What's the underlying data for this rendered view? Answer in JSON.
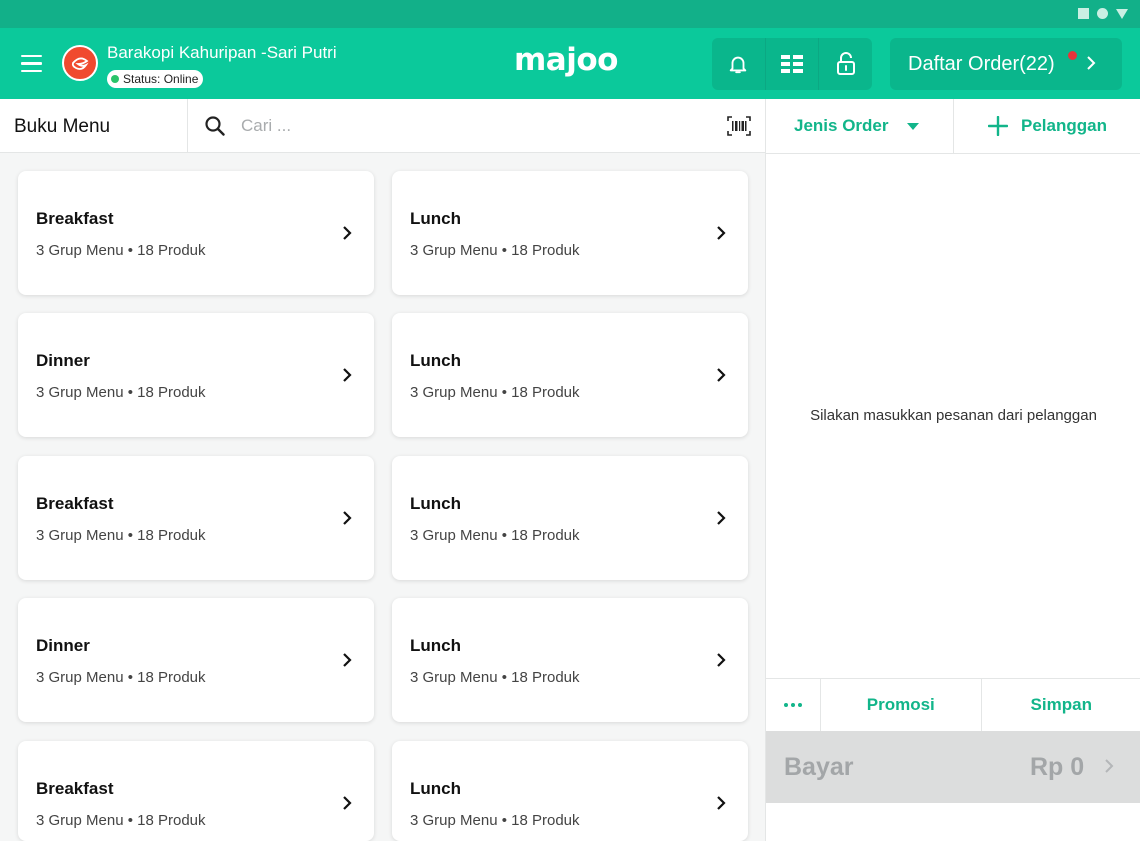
{
  "header": {
    "store_name": "Barakopi Kahuripan -Sari Putri",
    "status": "Status: Online",
    "brand": "majoo",
    "order_list_label": "Daftar Order(22)",
    "icons": [
      "menu-icon",
      "bell-icon",
      "grid-view-icon",
      "unlock-icon",
      "chevron-right-icon"
    ]
  },
  "menu_book": {
    "title": "Buku Menu",
    "search_placeholder": "Cari ..."
  },
  "menu_cards": [
    {
      "title": "Breakfast",
      "subtitle": "3 Grup Menu • 18 Produk"
    },
    {
      "title": "Lunch",
      "subtitle": "3 Grup Menu • 18 Produk"
    },
    {
      "title": "Dinner",
      "subtitle": "3 Grup Menu • 18 Produk"
    },
    {
      "title": "Lunch",
      "subtitle": "3 Grup Menu • 18 Produk"
    },
    {
      "title": "Breakfast",
      "subtitle": "3 Grup Menu • 18 Produk"
    },
    {
      "title": "Lunch",
      "subtitle": "3 Grup Menu • 18 Produk"
    },
    {
      "title": "Dinner",
      "subtitle": "3 Grup Menu • 18 Produk"
    },
    {
      "title": "Lunch",
      "subtitle": "3 Grup Menu • 18 Produk"
    },
    {
      "title": "Breakfast",
      "subtitle": "3 Grup Menu • 18 Produk"
    },
    {
      "title": "Lunch",
      "subtitle": "3 Grup Menu • 18 Produk"
    }
  ],
  "order_panel": {
    "order_type_label": "Jenis Order",
    "customer_label": "Pelanggan",
    "empty_message": "Silakan masukkan pesanan dari pelanggan",
    "promo_label": "Promosi",
    "save_label": "Simpan",
    "pay_label": "Bayar",
    "pay_amount": "Rp 0"
  },
  "colors": {
    "brand_green": "#0bc99b",
    "accent_green": "#12b58a",
    "notification_red": "#e8343a"
  }
}
